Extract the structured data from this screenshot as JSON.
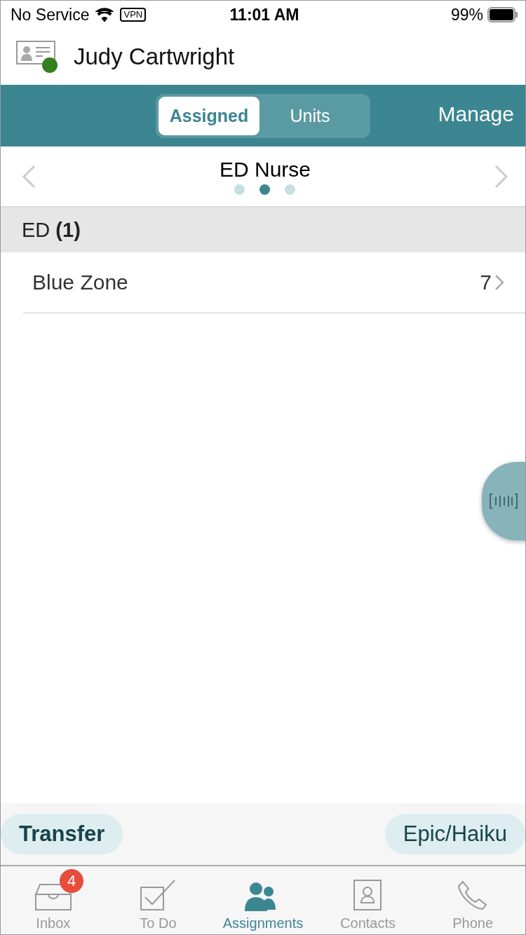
{
  "status_bar": {
    "carrier": "No Service",
    "vpn": "VPN",
    "time": "11:01 AM",
    "battery": "99%"
  },
  "header": {
    "name": "Judy Cartwright",
    "presence": {
      "color": "#34801f"
    }
  },
  "segments": [
    {
      "label": "Assigned",
      "selected": true
    },
    {
      "label": "Units",
      "selected": false
    }
  ],
  "manage": "Manage",
  "pager": {
    "title": "ED Nurse",
    "dots": [
      {
        "selected": false
      },
      {
        "selected": true
      },
      {
        "selected": false
      }
    ]
  },
  "section": {
    "name": "ED",
    "count": "(1)"
  },
  "rows": [
    {
      "label": "Blue Zone",
      "count": "7"
    }
  ],
  "actions": {
    "left": "Transfer",
    "right": "Epic/Haiku"
  },
  "tabs": [
    {
      "kind": "inbox",
      "label": "Inbox",
      "badge": "4",
      "selected": false
    },
    {
      "kind": "todo",
      "label": "To Do",
      "selected": false
    },
    {
      "kind": "assignments",
      "label": "Assignments",
      "selected": true
    },
    {
      "kind": "contacts",
      "label": "Contacts",
      "selected": false
    },
    {
      "kind": "phone",
      "label": "Phone",
      "selected": false
    }
  ]
}
